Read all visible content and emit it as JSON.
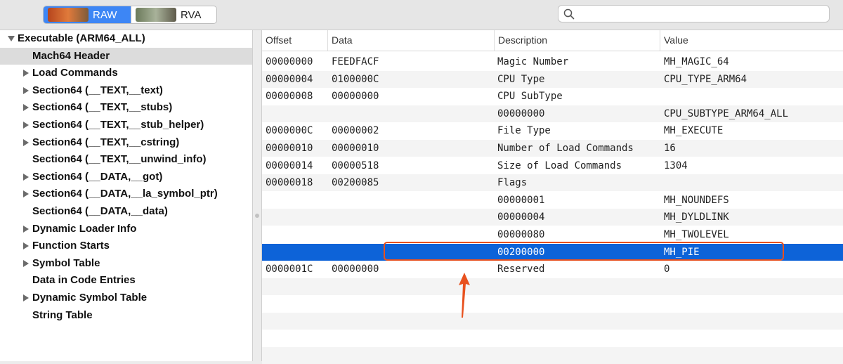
{
  "toolbar": {
    "raw_label": "RAW",
    "rva_label": "RVA",
    "search_placeholder": ""
  },
  "sidebar": {
    "items": [
      {
        "label": "Executable  (ARM64_ALL)",
        "expander": "down"
      },
      {
        "label": "Mach64 Header",
        "expander": "none",
        "selected": true
      },
      {
        "label": "Load Commands",
        "expander": "right"
      },
      {
        "label": "Section64 (__TEXT,__text)",
        "expander": "right"
      },
      {
        "label": "Section64 (__TEXT,__stubs)",
        "expander": "right"
      },
      {
        "label": "Section64 (__TEXT,__stub_helper)",
        "expander": "right"
      },
      {
        "label": "Section64 (__TEXT,__cstring)",
        "expander": "right"
      },
      {
        "label": "Section64 (__TEXT,__unwind_info)",
        "expander": "none"
      },
      {
        "label": "Section64 (__DATA,__got)",
        "expander": "right"
      },
      {
        "label": "Section64 (__DATA,__la_symbol_ptr)",
        "expander": "right"
      },
      {
        "label": "Section64 (__DATA,__data)",
        "expander": "none"
      },
      {
        "label": "Dynamic Loader Info",
        "expander": "right"
      },
      {
        "label": "Function Starts",
        "expander": "right"
      },
      {
        "label": "Symbol Table",
        "expander": "right"
      },
      {
        "label": "Data in Code Entries",
        "expander": "none"
      },
      {
        "label": "Dynamic Symbol Table",
        "expander": "right"
      },
      {
        "label": "String Table",
        "expander": "none"
      }
    ]
  },
  "table": {
    "columns": [
      "Offset",
      "Data",
      "Description",
      "Value"
    ],
    "rows": [
      {
        "offset": "00000000",
        "data": "FEEDFACF",
        "description": "Magic Number",
        "value": "MH_MAGIC_64"
      },
      {
        "offset": "00000004",
        "data": "0100000C",
        "description": "CPU Type",
        "value": "CPU_TYPE_ARM64"
      },
      {
        "offset": "00000008",
        "data": "00000000",
        "description": "CPU SubType",
        "value": ""
      },
      {
        "offset": "",
        "data": "",
        "description": "00000000",
        "value": "CPU_SUBTYPE_ARM64_ALL"
      },
      {
        "offset": "0000000C",
        "data": "00000002",
        "description": "File Type",
        "value": "MH_EXECUTE"
      },
      {
        "offset": "00000010",
        "data": "00000010",
        "description": "Number of Load Commands",
        "value": "16"
      },
      {
        "offset": "00000014",
        "data": "00000518",
        "description": "Size of Load Commands",
        "value": "1304"
      },
      {
        "offset": "00000018",
        "data": "00200085",
        "description": "Flags",
        "value": ""
      },
      {
        "offset": "",
        "data": "",
        "description": "00000001",
        "value": "MH_NOUNDEFS"
      },
      {
        "offset": "",
        "data": "",
        "description": "00000004",
        "value": "MH_DYLDLINK"
      },
      {
        "offset": "",
        "data": "",
        "description": "00000080",
        "value": "MH_TWOLEVEL"
      },
      {
        "offset": "",
        "data": "",
        "description": "00200000",
        "value": "MH_PIE",
        "selected": true
      },
      {
        "offset": "0000001C",
        "data": "00000000",
        "description": "Reserved",
        "value": "0"
      }
    ],
    "empty_rows": 5
  },
  "colors": {
    "selection": "#0d63d8",
    "annotation": "#e8511e",
    "segment_selected": "#3d86f5"
  },
  "icons": [
    "search-icon",
    "disclosure-triangle-icon",
    "arrow-annotation-icon"
  ]
}
